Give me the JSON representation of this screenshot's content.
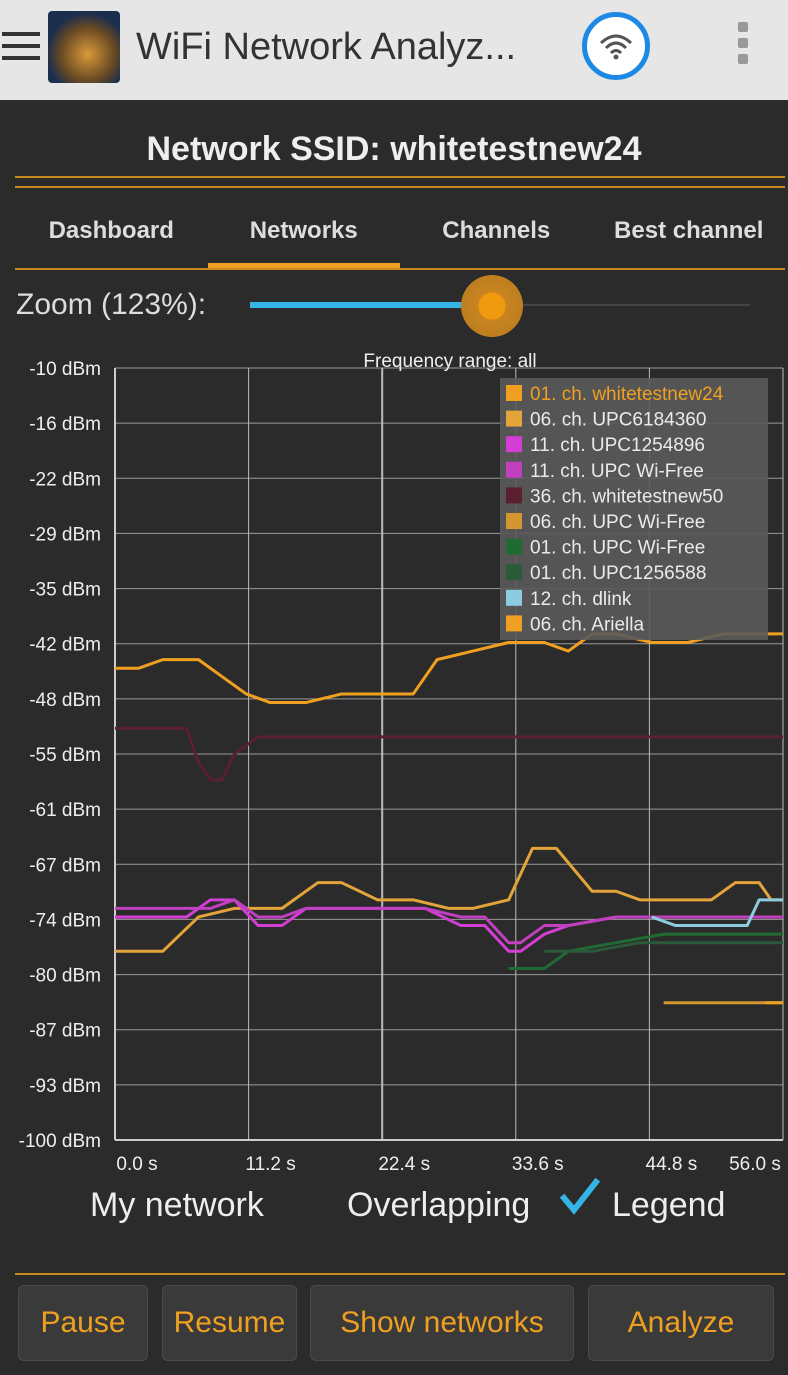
{
  "appbar": {
    "title": "WiFi Network Analyz...",
    "menu_icon": "hamburger-menu-icon",
    "app_icon": "wifi-analyzer-app-icon",
    "badge_icon": "wifi-badge-icon",
    "overflow_icon": "overflow-menu-icon"
  },
  "header": {
    "ssid_text": "Network SSID: whitetestnew24"
  },
  "tabs": [
    {
      "label": "Dashboard"
    },
    {
      "label": "Networks"
    },
    {
      "label": "Channels"
    },
    {
      "label": "Best channel"
    }
  ],
  "zoom": {
    "label": "Zoom (123%):",
    "value_percent": 123,
    "slider_fraction": 0.47
  },
  "chart_data": {
    "type": "line",
    "title": "Frequency range: all",
    "y_tick_labels": [
      "-10 dBm",
      "-16 dBm",
      "-22 dBm",
      "-29 dBm",
      "-35 dBm",
      "-42 dBm",
      "-48 dBm",
      "-55 dBm",
      "-61 dBm",
      "-67 dBm",
      "-74 dBm",
      "-80 dBm",
      "-87 dBm",
      "-93 dBm",
      "-100 dBm"
    ],
    "x_tick_labels": [
      "0.0 s",
      "11.2 s",
      "22.4 s",
      "33.6 s",
      "44.8 s",
      "56.0 s"
    ],
    "ylim": [
      -100,
      -10
    ],
    "xlim": [
      0,
      56
    ],
    "grid": true,
    "legend_position": "top-right",
    "series": [
      {
        "name": "01. ch. whitetestnew24",
        "color": "#f0a020",
        "x": [
          0,
          2,
          4,
          7,
          9,
          11,
          13,
          16,
          19,
          22,
          25,
          27,
          30,
          33,
          36,
          38,
          40,
          42,
          45,
          48,
          51,
          54,
          56
        ],
        "y": [
          -45,
          -45,
          -44,
          -44,
          -46,
          -48,
          -49,
          -49,
          -48,
          -48,
          -48,
          -44,
          -43,
          -42,
          -42,
          -43,
          -41,
          -41,
          -42,
          -42,
          -41,
          -41,
          -41
        ]
      },
      {
        "name": "06. ch. UPC6184360",
        "color": "#e3a43a",
        "x": [
          0,
          4,
          7,
          10,
          14,
          17,
          19,
          22,
          25,
          28,
          30,
          33,
          35,
          37,
          40,
          42,
          44,
          48,
          50,
          52,
          54,
          55,
          56
        ],
        "y": [
          -78,
          -78,
          -74,
          -73,
          -73,
          -70,
          -70,
          -72,
          -72,
          -73,
          -73,
          -72,
          -66,
          -66,
          -71,
          -71,
          -72,
          -72,
          -72,
          -70,
          -70,
          -72,
          -72
        ]
      },
      {
        "name": "11. ch. UPC1254896",
        "color": "#d43ed4",
        "x": [
          0,
          6,
          8,
          10,
          12,
          14,
          16,
          18,
          22,
          26,
          29,
          31,
          33,
          34,
          36,
          38,
          42,
          46,
          50,
          54,
          56
        ],
        "y": [
          -74,
          -74,
          -72,
          -72,
          -75,
          -75,
          -73,
          -73,
          -73,
          -73,
          -75,
          -75,
          -78,
          -78,
          -76,
          -75,
          -74,
          -74,
          -74,
          -74,
          -74
        ]
      },
      {
        "name": "11. ch. UPC Wi-Free",
        "color": "#c040c0",
        "x": [
          0,
          6,
          8,
          10,
          12,
          14,
          16,
          18,
          22,
          26,
          29,
          31,
          33,
          34,
          36,
          38,
          42,
          46,
          50,
          54,
          56
        ],
        "y": [
          -73,
          -73,
          -73,
          -72,
          -74,
          -74,
          -73,
          -73,
          -73,
          -73,
          -74,
          -74,
          -77,
          -77,
          -75,
          -75,
          -74,
          -74,
          -74,
          -74,
          -74
        ]
      },
      {
        "name": "36. ch. whitetestnew50",
        "color": "#5a2030",
        "x": [
          0,
          6,
          7,
          8,
          9,
          10,
          12,
          16,
          20,
          24,
          28,
          32,
          36,
          40,
          44,
          48,
          52,
          56
        ],
        "y": [
          -52,
          -52,
          -56,
          -58,
          -58,
          -55,
          -53,
          -53,
          -53,
          -53,
          -53,
          -53,
          -53,
          -53,
          -53,
          -53,
          -53,
          -53
        ]
      },
      {
        "name": "06. ch. UPC Wi-Free",
        "color": "#d39630",
        "x": [
          46,
          50,
          52,
          55,
          56
        ],
        "y": [
          -84,
          -84,
          -84,
          -84,
          -84
        ]
      },
      {
        "name": "01. ch. UPC Wi-Free",
        "color": "#1f6b32",
        "x": [
          33,
          36,
          38,
          42,
          46,
          50,
          54,
          56
        ],
        "y": [
          -80,
          -80,
          -78,
          -77,
          -76,
          -76,
          -76,
          -76
        ]
      },
      {
        "name": "01. ch. UPC1256588",
        "color": "#2b5a3a",
        "x": [
          36,
          40,
          44,
          48,
          52,
          56
        ],
        "y": [
          -78,
          -78,
          -77,
          -77,
          -77,
          -77
        ]
      },
      {
        "name": "12. ch. dlink",
        "color": "#8ccbe0",
        "x": [
          45,
          47,
          50,
          53,
          54,
          55,
          56
        ],
        "y": [
          -74,
          -75,
          -75,
          -75,
          -72,
          -72,
          -72
        ]
      },
      {
        "name": "06. ch. Ariella",
        "color": "#f0a020",
        "x": [
          54.5,
          56
        ],
        "y": [
          -84,
          -84
        ]
      }
    ]
  },
  "options": {
    "my_network": "My network",
    "overlapping": "Overlapping",
    "legend": "Legend",
    "legend_checked": true
  },
  "buttons": {
    "pause": "Pause",
    "resume": "Resume",
    "show_networks": "Show networks",
    "analyze": "Analyze"
  }
}
